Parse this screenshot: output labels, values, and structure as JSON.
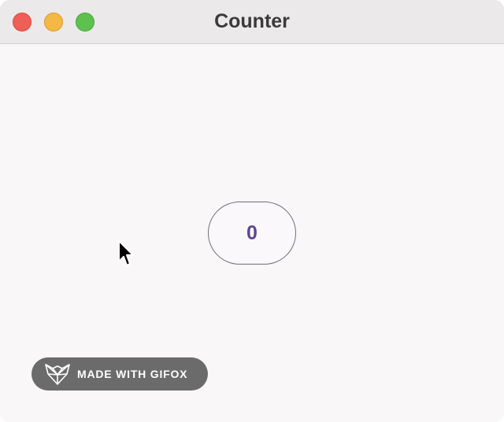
{
  "window": {
    "title": "Counter"
  },
  "counter": {
    "value": "0"
  },
  "badge": {
    "label": "MADE WITH GIFOX"
  },
  "icons": {
    "close": "close-traffic-light-icon",
    "minimize": "minimize-traffic-light-icon",
    "zoom": "zoom-traffic-light-icon",
    "cursor": "mouse-pointer-icon",
    "badge": "fox-icon"
  },
  "colors": {
    "close": "#ee5f57",
    "minimize": "#f4b845",
    "zoom": "#5ec14e",
    "counter_text": "#5f4591",
    "counter_border": "#716e76",
    "badge_bg": "#6b6b6b",
    "background": "#f9f7f8"
  }
}
